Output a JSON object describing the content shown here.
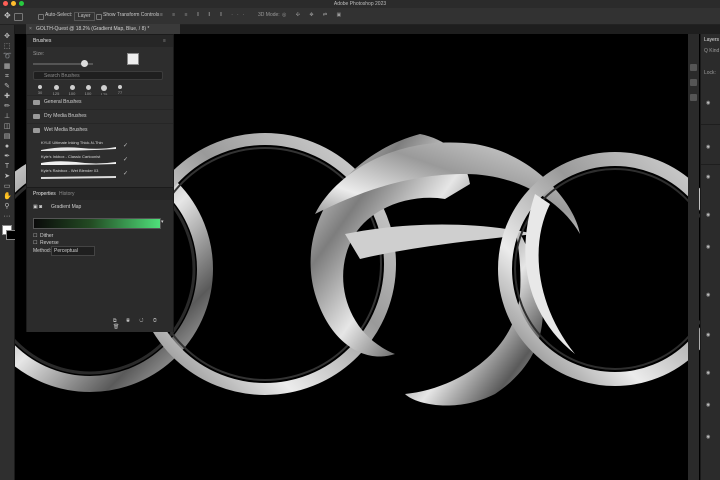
{
  "app": {
    "title": "Adobe Photoshop 2023",
    "colors": {
      "close": "#ff5f56",
      "minimize": "#ffbd2e",
      "maximize": "#27c93f"
    }
  },
  "options_bar": {
    "auto_select": "Auto-Select:",
    "layer_select": "Layer",
    "show_transform": "Show Transform Controls",
    "mode_3d": "3D Mode:"
  },
  "document": {
    "tab_title": "GOLTH-Quest @ 18.2% (Gradient Map, Blue, / 8) *"
  },
  "brushes_panel": {
    "title": "Brushes",
    "size_value": "Size:",
    "search_placeholder": "Search Brushes",
    "tips": [
      "30",
      "125",
      "100",
      "100",
      "175",
      "77"
    ],
    "folders": [
      "General Brushes",
      "Dry Media Brushes",
      "Wet Media Brushes"
    ],
    "items": [
      "KYLE Ultimate Inking Thick-N-Thin",
      "Kyle's Inkbox - Classic Cartoonist",
      "Kyle's Rainbox - Wet Blender 03"
    ]
  },
  "properties_panel": {
    "tab_active": "Properties",
    "tab_other": "History",
    "adjustment_name": "Gradient Map",
    "dither_label": "Dither",
    "reverse_label": "Reverse",
    "method_label": "Method:",
    "method_value": "Perceptual"
  },
  "layers_panel": {
    "title": "Layers",
    "kind_label": "Q Kind",
    "lock_label": "Lock:"
  }
}
